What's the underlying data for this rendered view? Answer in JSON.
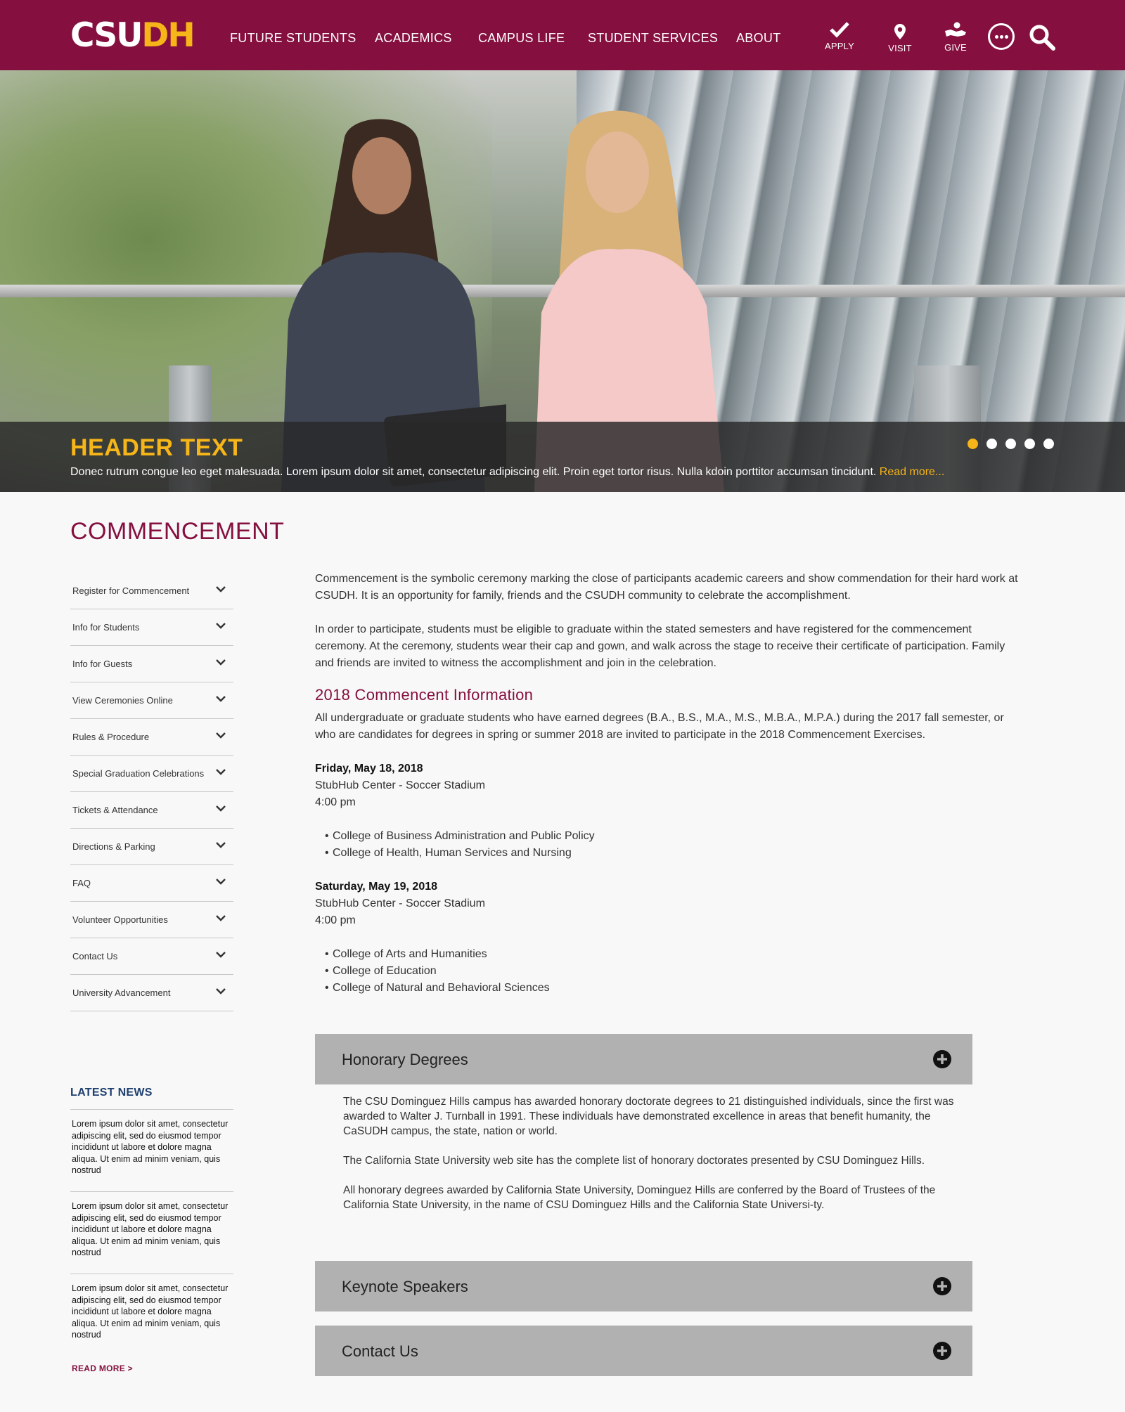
{
  "header": {
    "logo_csu": "CSU",
    "logo_dh": "DH",
    "nav": [
      "FUTURE STUDENTS",
      "ACADEMICS",
      "CAMPUS LIFE",
      "STUDENT SERVICES",
      "ABOUT"
    ],
    "utility": {
      "apply": "APPLY",
      "visit": "VISIT",
      "give": "GIVE"
    },
    "colors": {
      "brand": "#85103f",
      "accent": "#f6b518"
    }
  },
  "hero": {
    "title": "HEADER TEXT",
    "text": "Donec rutrum congue leo eget malesuada. Lorem ipsum dolor sit amet, consectetur adipiscing elit. Proin eget tortor risus. Nulla kdoin porttitor accumsan tincidunt.",
    "read_more": "Read more...",
    "slides_count": 5,
    "active_slide": 1
  },
  "page": {
    "title": "COMMENCEMENT"
  },
  "sidebar": {
    "items": [
      "Register for Commencement",
      "Info for Students",
      "Info for Guests",
      "View Ceremonies Online",
      "Rules & Procedure",
      "Special Graduation Celebrations",
      "Tickets & Attendance",
      "Directions & Parking",
      "FAQ",
      "Volunteer Opportunities",
      "Contact Us",
      "University Advancement"
    ],
    "news_title": "LATEST NEWS",
    "news": [
      "Lorem ipsum dolor sit amet, consectetur adipiscing elit, sed do eiusmod tempor incididunt ut labore et dolore magna aliqua. Ut enim ad minim veniam, quis nostrud",
      "Lorem ipsum dolor sit amet, consectetur adipiscing elit, sed do eiusmod tempor incididunt ut labore et dolore magna aliqua. Ut enim ad minim veniam, quis nostrud",
      "Lorem ipsum dolor sit amet, consectetur adipiscing elit, sed do eiusmod tempor incididunt ut labore et dolore magna aliqua. Ut enim ad minim veniam, quis nostrud"
    ],
    "news_more": "READ MORE >"
  },
  "main": {
    "intro1": "Commencement is the symbolic ceremony marking the close of participants academic careers and show commendation for their hard work at CSUDH. It is an opportunity for family, friends and the CSUDH community to celebrate the accomplishment.",
    "intro2": "In order to participate, students must be eligible to graduate within the stated semesters and have registered for the commencement ceremony. At the ceremony, students wear their cap and gown, and walk across the stage to receive their certificate of participation. Family and friends are invited to witness the accomplishment and join in the celebration.",
    "section_title": "2018 Commencent Information",
    "section_text": "All undergraduate or graduate students who have earned degrees (B.A., B.S., M.A., M.S., M.B.A., M.P.A.) during the 2017 fall semester, or who are candidates for degrees in spring or summer 2018 are invited to participate in the 2018 Commencement Exercises.",
    "ceremonies": [
      {
        "date": "Friday, May 18, 2018",
        "venue": "StubHub Center - Soccer Stadium",
        "time": "4:00 pm",
        "colleges": [
          "College of Business Administration and Public Policy",
          "College of Health, Human Services and Nursing"
        ]
      },
      {
        "date": "Saturday, May 19, 2018",
        "venue": "StubHub Center - Soccer Stadium",
        "time": "4:00 pm",
        "colleges": [
          "College of Arts and Humanities",
          "College of Education",
          "College of Natural and Behavioral Sciences"
        ]
      }
    ],
    "accordion": [
      {
        "title": "Honorary Degrees",
        "paragraphs": [
          "The CSU Dominguez Hills campus has awarded honorary doctorate degrees to 21 distinguished individuals, since the first was awarded to Walter J. Turnball in 1991. These individuals have demonstrated excellence in areas that benefit humanity, the CaSUDH campus, the state, nation or world.",
          "The California State University web site has the complete list of honorary doctorates presented by CSU Dominguez Hills.",
          "All honorary degrees awarded by California State University, Dominguez Hills are conferred by the Board of Trustees of the California State University, in the name of CSU Dominguez Hills and the California State Universi-ty."
        ]
      },
      {
        "title": "Keynote Speakers"
      },
      {
        "title": "Contact Us"
      }
    ]
  }
}
